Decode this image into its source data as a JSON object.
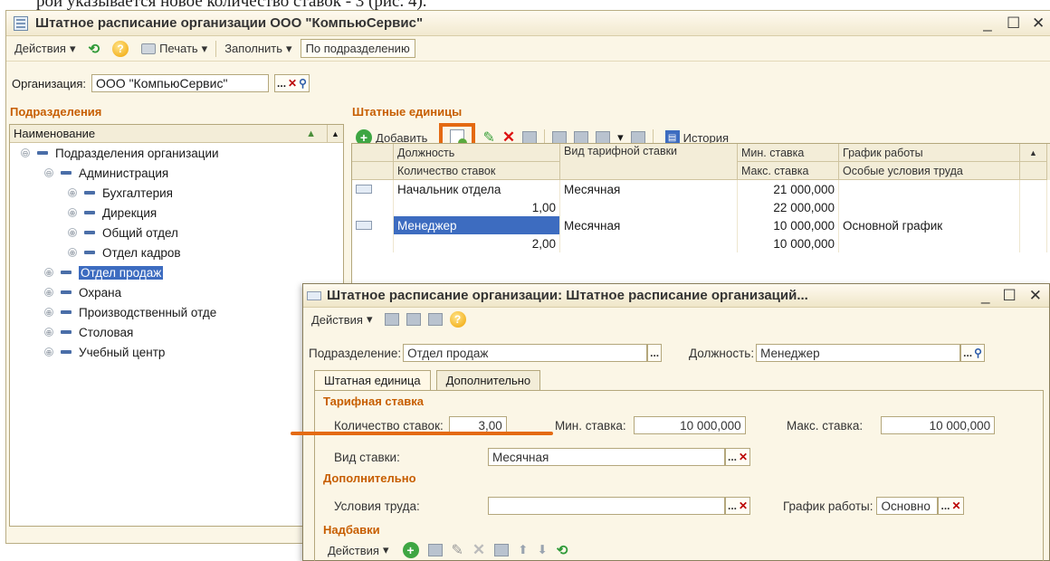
{
  "caption": "рой указывается новое количество ставок - 3 (рис. 4).",
  "main_window": {
    "title": "Штатное расписание организации ООО \"КомпьюСервис\"",
    "toolbar": {
      "actions": "Действия",
      "print": "Печать",
      "fill": "Заполнить",
      "by_department": "По подразделению"
    },
    "org_label": "Организация:",
    "org_value": "ООО \"КомпьюСервис\""
  },
  "departments": {
    "header": "Подразделения",
    "column": "Наименование",
    "items": [
      {
        "label": "Подразделения организации",
        "level": 0,
        "expander": "⊖",
        "selected": false
      },
      {
        "label": "Администрация",
        "level": 1,
        "expander": "⊖",
        "selected": false
      },
      {
        "label": "Бухгалтерия",
        "level": 2,
        "expander": "⊕",
        "selected": false
      },
      {
        "label": "Дирекция",
        "level": 2,
        "expander": "⊕",
        "selected": false
      },
      {
        "label": "Общий отдел",
        "level": 2,
        "expander": "⊕",
        "selected": false
      },
      {
        "label": "Отдел кадров",
        "level": 2,
        "expander": "⊕",
        "selected": false
      },
      {
        "label": "Отдел продаж",
        "level": 1,
        "expander": "⊕",
        "selected": true
      },
      {
        "label": "Охрана",
        "level": 1,
        "expander": "⊕",
        "selected": false
      },
      {
        "label": "Производственный отде",
        "level": 1,
        "expander": "⊕",
        "selected": false
      },
      {
        "label": "Столовая",
        "level": 1,
        "expander": "⊕",
        "selected": false
      },
      {
        "label": "Учебный центр",
        "level": 1,
        "expander": "⊕",
        "selected": false
      }
    ]
  },
  "units": {
    "header": "Штатные единицы",
    "add": "Добавить",
    "history": "История",
    "columns": {
      "position": "Должность",
      "count": "Количество ставок",
      "rate_type": "Вид тарифной ставки",
      "min_rate": "Мин. ставка",
      "max_rate": "Макс. ставка",
      "schedule": "График работы",
      "conditions": "Особые условия труда"
    },
    "rows": [
      {
        "position": "Начальник отдела",
        "count": "1,00",
        "rate_type": "Месячная",
        "min_rate": "21 000,000",
        "max_rate": "22 000,000",
        "schedule": ""
      },
      {
        "position": "Менеджер",
        "count": "2,00",
        "rate_type": "Месячная",
        "min_rate": "10 000,000",
        "max_rate": "10 000,000",
        "schedule": "Основной график"
      }
    ]
  },
  "dialog": {
    "title": "Штатное расписание организации: Штатное расписание организаций...",
    "actions": "Действия",
    "department_label": "Подразделение:",
    "department_value": "Отдел продаж",
    "position_label": "Должность:",
    "position_value": "Менеджер",
    "tabs": [
      "Штатная единица",
      "Дополнительно"
    ],
    "tariff_header": "Тарифная ставка",
    "count_label": "Количество ставок:",
    "count_value": "3,00",
    "min_label": "Мин. ставка:",
    "min_value": "10 000,000",
    "max_label": "Макс. ставка:",
    "max_value": "10 000,000",
    "rate_type_label": "Вид ставки:",
    "rate_type_value": "Месячная",
    "additional_header": "Дополнительно",
    "conditions_label": "Условия труда:",
    "conditions_value": "",
    "schedule_label": "График работы:",
    "schedule_value": "Основно",
    "allowances_header": "Надбавки",
    "allowances_actions": "Действия"
  },
  "colors": {
    "accent_orange": "#e46a12",
    "section_orange": "#c75e00",
    "selection_blue": "#3d6cc0",
    "window_bg": "#fbf6e6"
  }
}
